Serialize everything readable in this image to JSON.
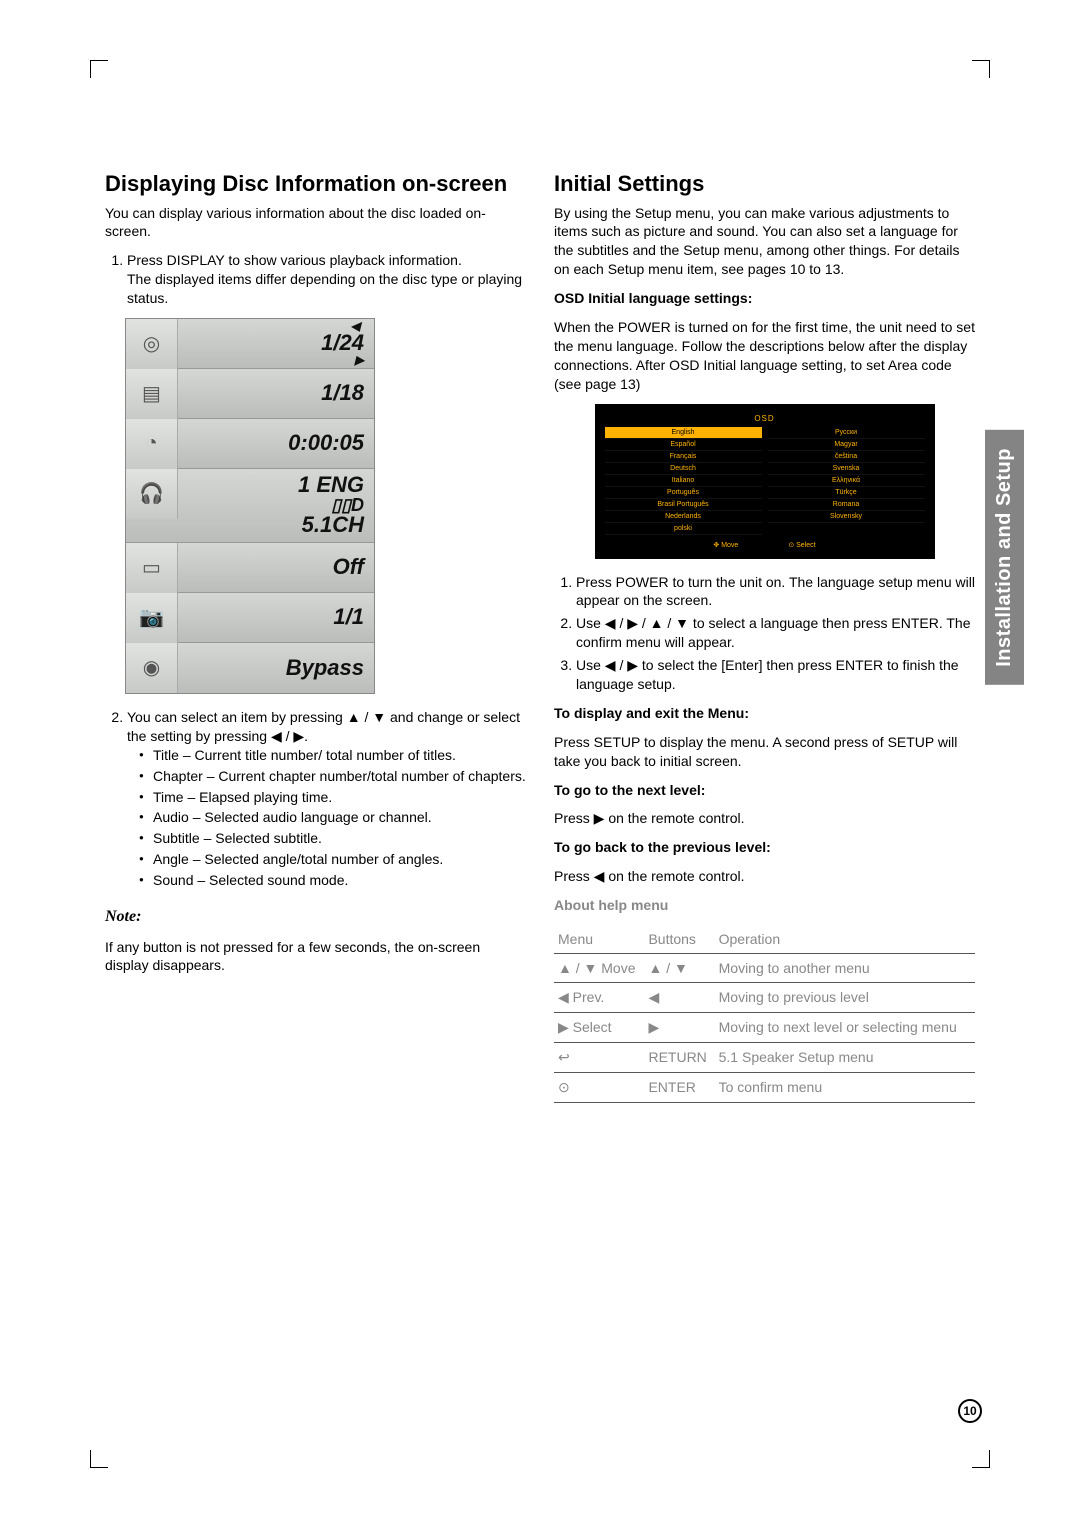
{
  "left": {
    "heading": "Displaying Disc Information on-screen",
    "intro": "You can display various information about the disc loaded on-screen.",
    "step1a": "Press DISPLAY to show various playback information.",
    "step1b": "The displayed items differ depending on the disc type or playing status.",
    "osd": {
      "title_val": "1/24",
      "chapter_val": "1/18",
      "time_val": "0:00:05",
      "audio_lang": "1 ENG",
      "audio_ch": "5.1CH",
      "subtitle": "Off",
      "angle": "1/1",
      "sound": "Bypass"
    },
    "step2_lead": "You can select an item by pressing ▲ / ▼ and change or select the setting by pressing ◀ / ▶.",
    "bullets": {
      "title": "Title – Current title number/ total number of titles.",
      "chapter": "Chapter – Current chapter number/total number of chapters.",
      "time": "Time – Elapsed playing time.",
      "audio": "Audio – Selected audio language or channel.",
      "subtitle": "Subtitle – Selected subtitle.",
      "angle": "Angle – Selected angle/total number of angles.",
      "sound": "Sound – Selected sound mode."
    },
    "note_head": "Note:",
    "note_body": "If any button is not pressed for a few seconds, the on-screen display disappears."
  },
  "right": {
    "heading": "Initial Settings",
    "intro": "By using the Setup menu, you can make various adjustments to items such as picture and sound. You can also set a language for the subtitles and the Setup menu, among other things. For details on each Setup menu item, see pages 10 to 13.",
    "osd_lang_head": "OSD Initial language settings:",
    "osd_lang_body": "When the POWER is turned on for the first time, the unit need to set the menu language. Follow the descriptions below after the display connections. After OSD Initial language setting, to set Area code (see page 13)",
    "lang_osd": {
      "title": "OSD",
      "left_items": [
        "English",
        "Español",
        "Français",
        "Deutsch",
        "Italiano",
        "Português",
        "Brasil Português",
        "Nederlands",
        "polski"
      ],
      "right_items": [
        "Русски",
        "Magyar",
        "čeština",
        "Svenska",
        "Ελληνικά",
        "Türkçe",
        "Romana",
        "Slovensky"
      ],
      "foot_move": "Move",
      "foot_select": "Select"
    },
    "steps": {
      "s1": "Press POWER to turn the unit on. The language setup menu will appear on the screen.",
      "s2": "Use ◀ / ▶ / ▲ / ▼ to select a language then press ENTER. The confirm menu will appear.",
      "s3": "Use ◀ / ▶ to select the [Enter] then press ENTER to finish the language setup."
    },
    "disp_head": "To display and exit the Menu:",
    "disp_body": "Press SETUP to display the menu. A second press of SETUP will take you back to initial screen.",
    "next_head": "To go to the next level:",
    "next_body": "Press ▶ on the remote control.",
    "prev_head": "To go back to the previous level:",
    "prev_body": "Press ◀ on the remote control.",
    "about_head": "About help menu",
    "table": {
      "h1": "Menu",
      "h2": "Buttons",
      "h3": "Operation",
      "r1c1": "▲ / ▼ Move",
      "r1c2": "▲ / ▼",
      "r1c3": "Moving to another menu",
      "r2c1": "◀ Prev.",
      "r2c2": "◀",
      "r2c3": "Moving to previous level",
      "r3c1": "▶ Select",
      "r3c2": "▶",
      "r3c3": "Moving to next level or selecting menu",
      "r4c1": "↩",
      "r4c2": "RETURN",
      "r4c3": "5.1 Speaker Setup menu",
      "r5c1": "⊙",
      "r5c2": "ENTER",
      "r5c3": "To confirm menu"
    }
  },
  "sidetab": "Installation and Setup",
  "page_number": "10"
}
